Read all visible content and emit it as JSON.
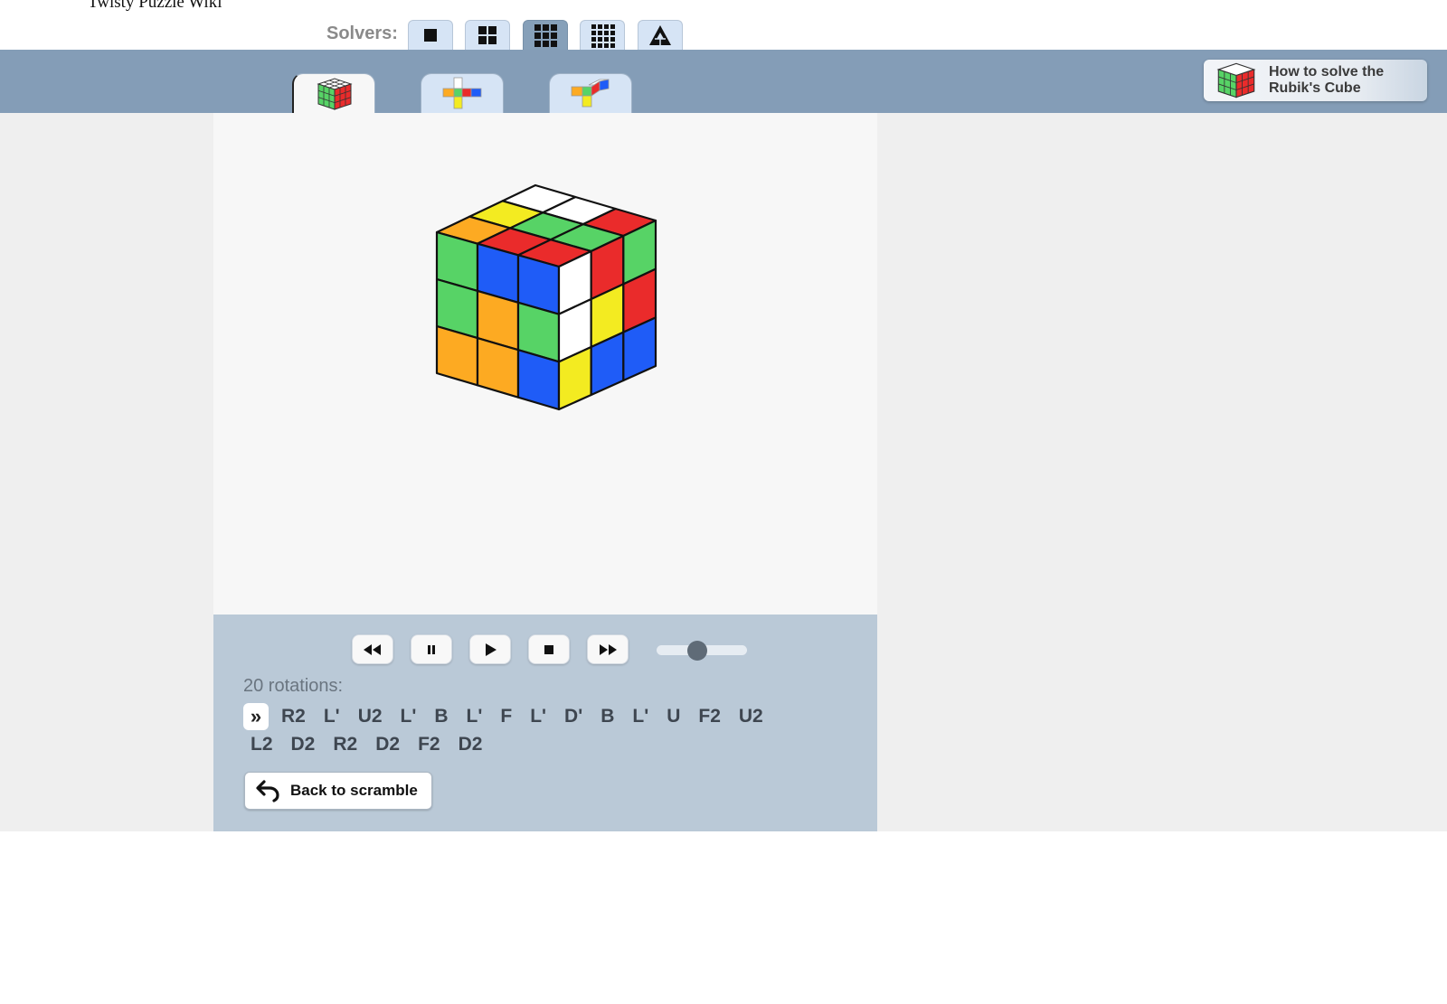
{
  "site": {
    "title": "Twisty Puzzle Wiki"
  },
  "solvers": {
    "label": "Solvers:",
    "buttons": [
      {
        "name": "1x1-solver",
        "icon": "square-1x1-icon",
        "active": false
      },
      {
        "name": "2x2-solver",
        "icon": "grid-2x2-icon",
        "active": false
      },
      {
        "name": "3x3-solver",
        "icon": "grid-3x3-icon",
        "active": true
      },
      {
        "name": "4x4-solver",
        "icon": "grid-4x4-icon",
        "active": false
      },
      {
        "name": "pyraminx-solver",
        "icon": "triangle-pyraminx-icon",
        "active": false
      }
    ]
  },
  "view_tabs": [
    {
      "name": "3d-view",
      "icon": "cube-3d-icon",
      "active": true
    },
    {
      "name": "net-view",
      "icon": "cube-net-icon",
      "active": false
    },
    {
      "name": "partial-net-view",
      "icon": "cube-partial-net-icon",
      "active": false
    }
  ],
  "howto": {
    "label_line1": "How to solve the",
    "label_line2": "Rubik's Cube",
    "icon": "rubiks-cube-icon"
  },
  "colors": {
    "green": "#57d366",
    "blue": "#1f5cf7",
    "orange": "#fdaa22",
    "white": "#ffffff",
    "yellow": "#f3eb21",
    "red": "#ea2b2b"
  },
  "cube": {
    "top": [
      [
        "white",
        "white",
        "red"
      ],
      [
        "yellow",
        "green",
        "green"
      ],
      [
        "orange",
        "red",
        "red"
      ]
    ],
    "front": [
      [
        "green",
        "blue",
        "blue"
      ],
      [
        "green",
        "orange",
        "green"
      ],
      [
        "orange",
        "orange",
        "blue"
      ]
    ],
    "right": [
      [
        "white",
        "red",
        "green"
      ],
      [
        "white",
        "yellow",
        "red"
      ],
      [
        "yellow",
        "blue",
        "blue"
      ]
    ]
  },
  "playback": {
    "buttons": [
      {
        "name": "rewind-button",
        "icon": "rewind-icon"
      },
      {
        "name": "pause-button",
        "icon": "pause-icon"
      },
      {
        "name": "play-button",
        "icon": "play-icon"
      },
      {
        "name": "stop-button",
        "icon": "stop-icon"
      },
      {
        "name": "fast-forward-button",
        "icon": "fast-forward-icon"
      }
    ],
    "speed": 0.45
  },
  "solution": {
    "count_label": "20 rotations:",
    "marker": "»",
    "line1": [
      "R2",
      "L'",
      "U2",
      "L'",
      "B",
      "L'",
      "F",
      "L'",
      "D'",
      "B",
      "L'",
      "U",
      "F2",
      "U2"
    ],
    "line2": [
      "L2",
      "D2",
      "R2",
      "D2",
      "F2",
      "D2"
    ]
  },
  "back_button": {
    "label": "Back to scramble",
    "icon": "undo-arrow-icon"
  }
}
